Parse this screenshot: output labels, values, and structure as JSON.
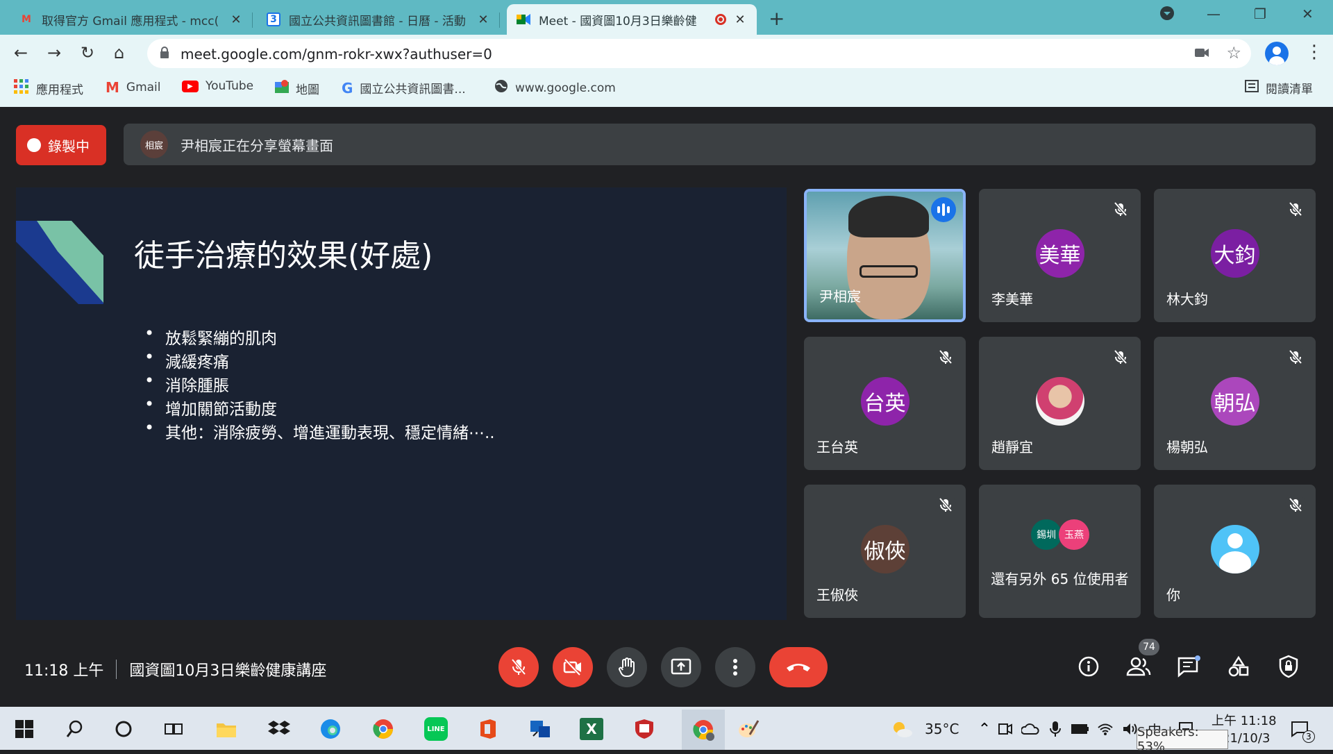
{
  "browser": {
    "tabs": [
      {
        "title": "取得官方 Gmail 應用程式 - mcc(",
        "icon": "gmail-icon"
      },
      {
        "title": "國立公共資訊圖書館 - 日曆 - 活動",
        "icon": "calendar-icon",
        "icon_text": "3"
      },
      {
        "title": "Meet - 國資圖10月3日樂齡健",
        "icon": "meet-icon"
      }
    ],
    "url": "meet.google.com/gnm-rokr-xwx?authuser=0",
    "bookmarks": [
      "應用程式",
      "Gmail",
      "YouTube",
      "地圖",
      "國立公共資訊圖書...",
      "www.google.com"
    ],
    "reading_list": "閱讀清單"
  },
  "meet": {
    "recording_label": "錄製中",
    "sharer_avatar": "相宸",
    "share_text": "尹相宸正在分享螢幕畫面",
    "slide": {
      "title": "徒手治療的效果(好處)",
      "bullets": [
        "放鬆緊繃的肌肉",
        "減緩疼痛",
        "消除腫脹",
        "增加關節活動度",
        "其他：消除疲勞、增進運動表現、穩定情緒⋯.."
      ]
    },
    "participants": [
      {
        "name": "尹相宸",
        "avatar": "",
        "color": "#3a6b7a"
      },
      {
        "name": "李美華",
        "avatar": "美華",
        "color": "#8e24aa"
      },
      {
        "name": "林大鈞",
        "avatar": "大鈞",
        "color": "#7b1fa2"
      },
      {
        "name": "王台英",
        "avatar": "台英",
        "color": "#8e24aa"
      },
      {
        "name": "趙靜宜",
        "avatar": "",
        "color": "#d9a08a"
      },
      {
        "name": "楊朝弘",
        "avatar": "朝弘",
        "color": "#ab47bc"
      },
      {
        "name": "王俶俠",
        "avatar": "俶俠",
        "color": "#5d4037"
      },
      {
        "name": "還有另外 65 位使用者",
        "avatar": "",
        "color": ""
      },
      {
        "name": "你",
        "avatar": "",
        "color": "#4fc3f7"
      }
    ],
    "more_avatars": [
      "錫圳",
      "玉燕"
    ],
    "time": "11:18 上午",
    "meeting_title": "國資圖10月3日樂齡健康講座",
    "participant_count": "74"
  },
  "taskbar": {
    "weather": "35°C",
    "clock_time": "上午 11:18",
    "clock_date": "21/10/3",
    "ime": "中",
    "notification_count": "3",
    "speakers_tooltip": "Speakers: 53%"
  },
  "colors": {
    "tab_bar": "#5fb9c3",
    "meet_bg": "#202124",
    "red": "#ea4335",
    "speaking_border": "#8ab4f8"
  }
}
